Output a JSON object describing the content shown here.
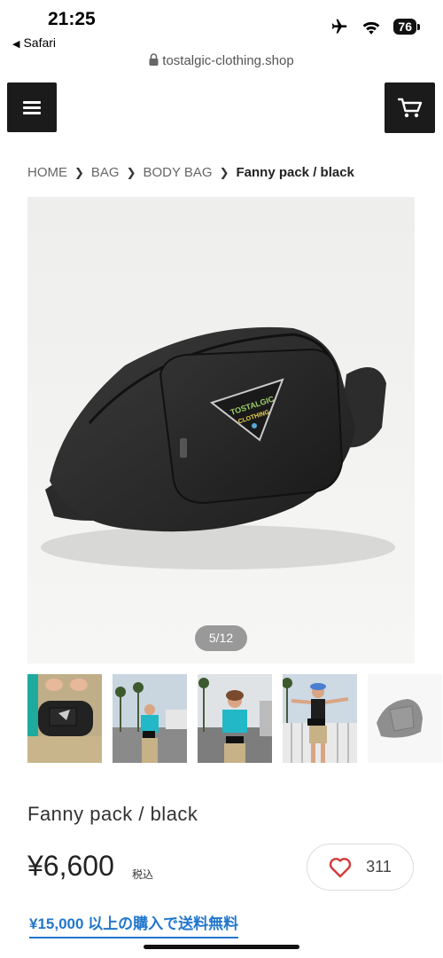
{
  "status": {
    "time": "21:25",
    "back_label": "Safari",
    "battery": "76"
  },
  "url": "tostalgic-clothing.shop",
  "breadcrumb": {
    "items": [
      "HOME",
      "BAG",
      "BODY BAG"
    ],
    "current": "Fanny pack / black"
  },
  "gallery": {
    "counter": "5/12",
    "patch_text_top": "TOSTALGIC",
    "patch_text_bottom": "CLOTHING"
  },
  "product": {
    "name": "Fanny pack / black",
    "price": "¥6,600",
    "tax_label": "税込",
    "like_count": "311"
  },
  "shipping_notice": "¥15,000 以上の購入で送料無料",
  "colors": {
    "header_button_bg": "#1b1b1b",
    "link_blue": "#2277cc",
    "heart_red": "#d23a3a"
  }
}
